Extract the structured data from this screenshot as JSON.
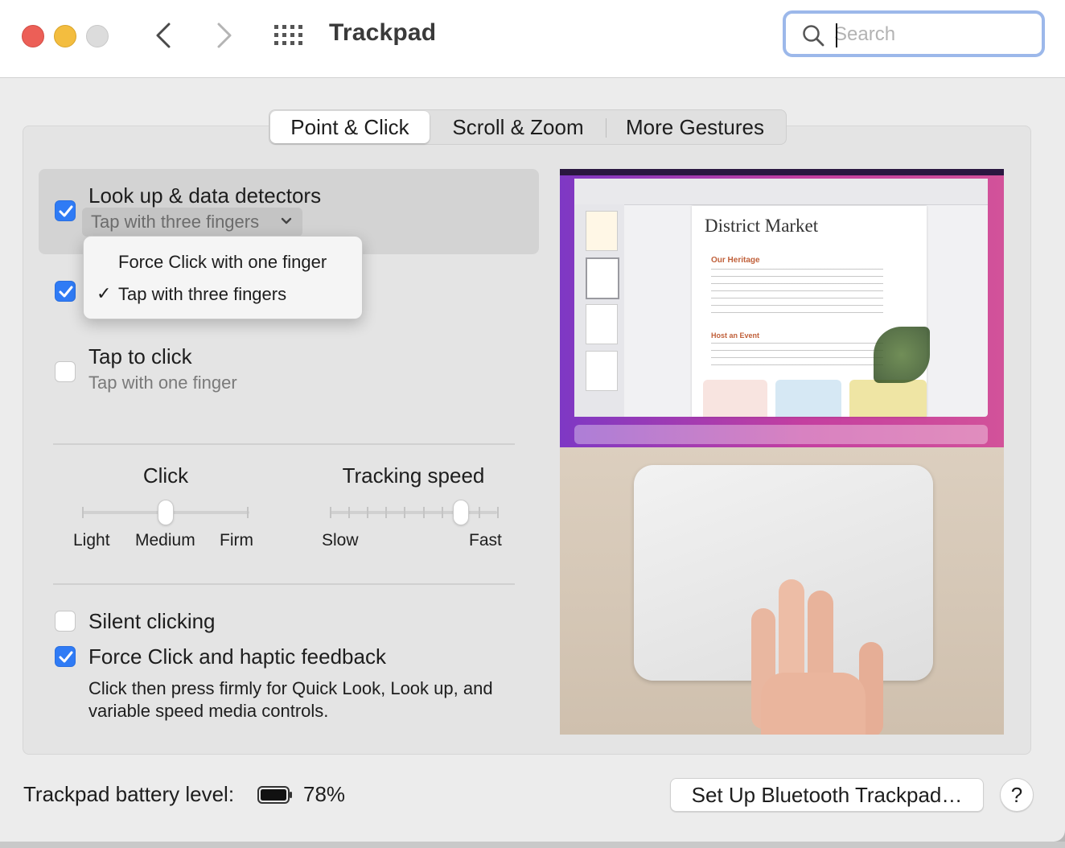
{
  "window": {
    "title": "Trackpad"
  },
  "search": {
    "placeholder": "Search",
    "value": ""
  },
  "tabs": [
    {
      "label": "Point & Click",
      "active": true
    },
    {
      "label": "Scroll & Zoom",
      "active": false
    },
    {
      "label": "More Gestures",
      "active": false
    }
  ],
  "options": {
    "lookup": {
      "title": "Look up & data detectors",
      "checked": true,
      "popup_value": "Tap with three fingers"
    },
    "secondary": {
      "checked": true
    },
    "tap_to_click": {
      "title": "Tap to click",
      "subtitle": "Tap with one finger",
      "checked": false
    },
    "silent_clicking": {
      "title": "Silent clicking",
      "checked": false
    },
    "force_click": {
      "title": "Force Click and haptic feedback",
      "checked": true,
      "description": "Click then press firmly for Quick Look, Look up, and variable speed media controls."
    }
  },
  "popup_menu": {
    "items": [
      {
        "label": "Force Click with one finger",
        "selected": false
      },
      {
        "label": "Tap with three fingers",
        "selected": true
      }
    ]
  },
  "sliders": {
    "click": {
      "title": "Click",
      "labels": [
        "Light",
        "Medium",
        "Firm"
      ],
      "value_index": 1,
      "steps": 3
    },
    "tracking": {
      "title": "Tracking speed",
      "labels": [
        "Slow",
        "Fast"
      ],
      "value_index": 7,
      "steps": 10
    }
  },
  "preview": {
    "document_title": "District Market",
    "section_1": "Our Heritage",
    "section_2": "Host an Event"
  },
  "footer": {
    "battery_label": "Trackpad battery level:",
    "battery_percent": "78%",
    "battery_fraction": 0.78,
    "setup_button": "Set Up Bluetooth Trackpad…",
    "help_button": "?"
  },
  "colors": {
    "accent": "#2f7bf5",
    "close": "#ec5f57",
    "minimize": "#f3bd3f",
    "zoom_disabled": "#dcdcdc"
  }
}
